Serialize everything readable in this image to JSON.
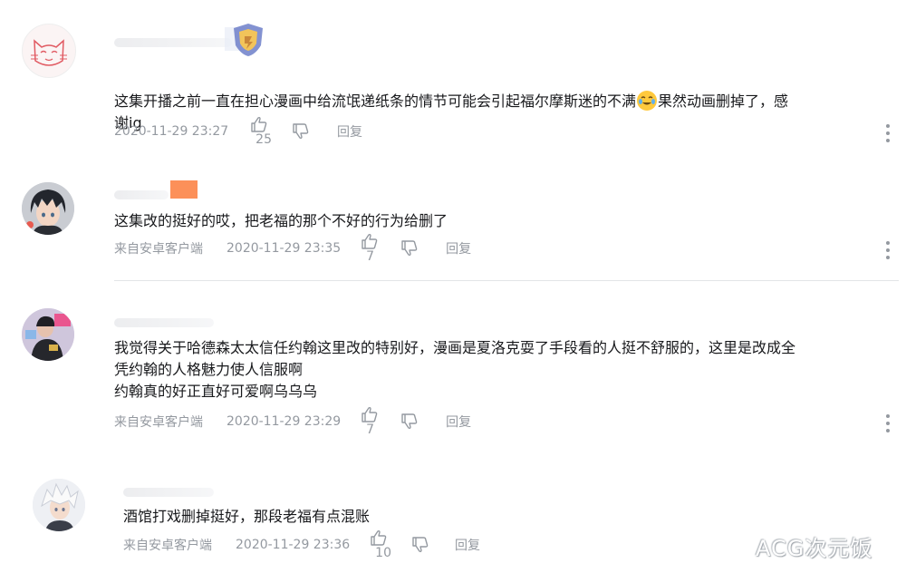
{
  "comments": [
    {
      "text_part1": "这集开播之前一直在担心漫画中给流氓递纸条的情节可能会引起福尔摩斯迷的不满",
      "text_part2": "果然动画删掉了，感",
      "text_part3": "谢ig",
      "emoji": "crying-laughing-emoji",
      "source": "",
      "time": "2020-11-29 23:27",
      "likes": "25",
      "reply": "回复"
    },
    {
      "text": "这集改的挺好的哎，把老福的那个不好的行为给删了",
      "source": "来自安卓客户端",
      "time": "2020-11-29 23:35",
      "likes": "7",
      "reply": "回复"
    },
    {
      "text": "我觉得关于哈德森太太信任约翰这里改的特别好，漫画是夏洛克耍了手段看的人挺不舒服的，这里是改成全\n凭约翰的人格魅力使人信服啊\n约翰真的好正直好可爱啊乌乌乌",
      "source": "来自安卓客户端",
      "time": "2020-11-29 23:29",
      "likes": "7",
      "reply": "回复"
    },
    {
      "text": "酒馆打戏删掉挺好，那段老福有点混账",
      "source": "来自安卓客户端",
      "time": "2020-11-29 23:36",
      "likes": "10",
      "reply": "回复"
    }
  ],
  "watermark": "ACG次元饭",
  "colors": {
    "text": "#18191c",
    "meta": "#9499a0",
    "divider": "#e3e5e7",
    "badge_orange": "#fb7d3c"
  }
}
